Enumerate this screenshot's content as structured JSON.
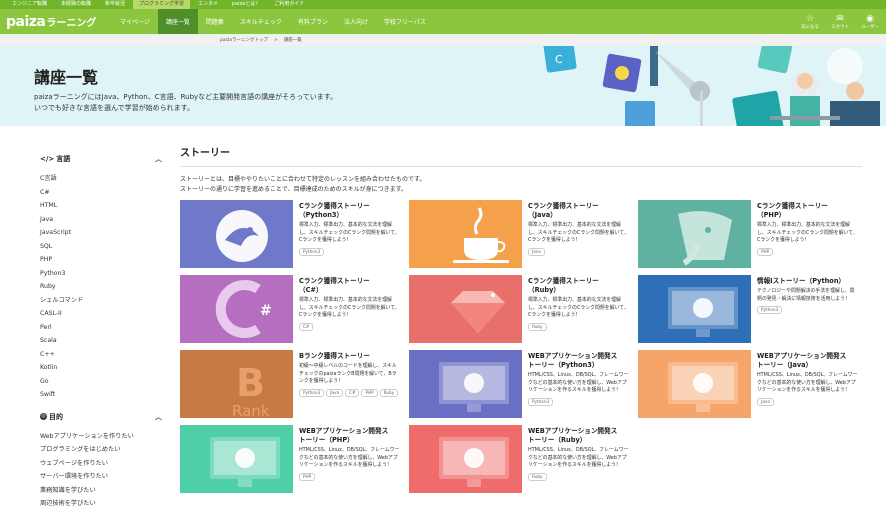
{
  "topbar": {
    "items": [
      {
        "label": "エンジニア転職",
        "active": false
      },
      {
        "label": "未経験の転職",
        "active": false
      },
      {
        "label": "新卒就活",
        "active": false
      },
      {
        "label": "プログラミング学習",
        "active": true
      },
      {
        "label": "エンタメ",
        "active": false
      },
      {
        "label": "paizaとは？",
        "active": false
      },
      {
        "label": "ご利用ガイド",
        "active": false
      }
    ]
  },
  "header": {
    "logo_mark": "paiza",
    "logo_text": "ラーニング",
    "nav": [
      {
        "label": "マイページ",
        "active": false
      },
      {
        "label": "講座一覧",
        "active": true
      },
      {
        "label": "問題集",
        "active": false
      },
      {
        "label": "スキルチェック",
        "active": false
      },
      {
        "label": "有料プラン",
        "active": false
      },
      {
        "label": "法人向け",
        "active": false
      },
      {
        "label": "学校フリーパス",
        "active": false
      }
    ],
    "actions": [
      {
        "label": "気になる",
        "icon": "star-icon"
      },
      {
        "label": "スカウト",
        "icon": "mail-icon"
      },
      {
        "label": "ユーザー",
        "icon": "user-icon"
      }
    ]
  },
  "breadcrumb": {
    "home": "paizaラーニングトップ",
    "sep": ">",
    "current": "講座一覧"
  },
  "hero": {
    "title": "講座一覧",
    "desc1": "paizaラーニングにはJava、Python、C言語、Rubyなど主要開発言語の講座がそろっています。",
    "desc2": "いつでも好きな言語を選んで学習が始められます。"
  },
  "sidebar": {
    "languages_title": "言語",
    "languages": [
      "C言語",
      "C#",
      "HTML",
      "Java",
      "JavaScript",
      "SQL",
      "PHP",
      "Python3",
      "Ruby",
      "シェルコマンド",
      "CASL-II",
      "Perl",
      "Scala",
      "C++",
      "Kotlin",
      "Go",
      "Swift"
    ],
    "purpose_title": "目的",
    "purposes": [
      "Webアプリケーションを作りたい",
      "プログラミングをはじめたい",
      "ウェブページを作りたい",
      "サーバー環境を作りたい",
      "業務知識を学びたい",
      "周辺技術を学びたい"
    ]
  },
  "content": {
    "section_title": "ストーリー",
    "desc1": "ストーリーとは、目標ややりたいことに合わせて特定のレッスンを組み合わせたものです。",
    "desc2": "ストーリーの通りに学習を進めることで、目標達成のためのスキルが身につきます。",
    "cards": [
      {
        "title1": "Cランク獲得ストーリー",
        "title2": "（Python3）",
        "text": "標準入力、標準出力、基本的な文法を理解し、スキルチェックのCランク問題を解いて、Cランクを獲得しよう！",
        "tags": [
          "Python3"
        ],
        "color": "#7079c9",
        "icon": "python-icon"
      },
      {
        "title1": "Cランク獲得ストーリー",
        "title2": "（Java）",
        "text": "標準入力、標準出力、基本的な文法を理解し、スキルチェックのCランク問題を解いて、Cランクを獲得しよう！",
        "tags": [
          "Java"
        ],
        "color": "#f5a04a",
        "icon": "java-icon"
      },
      {
        "title1": "Cランク獲得ストーリー",
        "title2": "（PHP）",
        "text": "標準入力、標準出力、基本的な文法を理解し、スキルチェックのCランク問題を解いて、Cランクを獲得しよう！",
        "tags": [
          "PHP"
        ],
        "color": "#5fb29f",
        "icon": "php-icon"
      },
      {
        "title1": "Cランク獲得ストーリー",
        "title2": "（C#）",
        "text": "標準入力、標準出力、基本的な文法を理解し、スキルチェックのCランク問題を解いて、Cランクを獲得しよう！",
        "tags": [
          "C#"
        ],
        "color": "#b66fc0",
        "icon": "csharp-icon"
      },
      {
        "title1": "Cランク獲得ストーリー",
        "title2": "（Ruby）",
        "text": "標準入力、標準出力、基本的な文法を理解し、スキルチェックのCランク問題を解いて、Cランクを獲得しよう！",
        "tags": [
          "Ruby"
        ],
        "color": "#e8706a",
        "icon": "ruby-icon"
      },
      {
        "title1": "情報Iストーリー（Python）",
        "title2": "",
        "text": "テクノロジーや問題解決の手法を理解し、問題の発見・解決に情報技術を活用しよう！",
        "tags": [
          "Python3"
        ],
        "color": "#2f6fb7",
        "icon": "monitor-icon"
      },
      {
        "title1": "Bランク獲得ストーリー",
        "title2": "",
        "text": "初級〜中級レベルのコードを理解し、スキルチェックのpaizaランクB問題を解いて、Bランクを獲得しよう！",
        "tags": [
          "Python3",
          "Java",
          "C#",
          "PHP",
          "Ruby"
        ],
        "color": "#c87a45",
        "icon": "rank-b-icon",
        "thumb_text": "B",
        "thumb_sub": "Rank"
      },
      {
        "title1": "WEBアプリケーション開発ス",
        "title2": "トーリー（Python3）",
        "text": "HTML/CSS、Linux、DB/SQL、フレームワークなどの基本的な使い方を理解し、Webアプリケーションを作るスキルを獲得しよう！",
        "tags": [
          "Python3"
        ],
        "color": "#6b6fc4",
        "icon": "monitor-icon"
      },
      {
        "title1": "WEBアプリケーション開発ス",
        "title2": "トーリー（Java）",
        "text": "HTML/CSS、Linux、DB/SQL、フレームワークなどの基本的な使い方を理解し、Webアプリケーションを作るスキルを獲得しよう！",
        "tags": [
          "Java"
        ],
        "color": "#f5a56a",
        "icon": "monitor-icon"
      },
      {
        "title1": "WEBアプリケーション開発ス",
        "title2": "トーリー（PHP）",
        "text": "HTML/CSS、Linux、DB/SQL、フレームワークなどの基本的な使い方を理解し、Webアプリケーションを作るスキルを獲得しよう！",
        "tags": [
          "PHP"
        ],
        "color": "#4fcfa8",
        "icon": "monitor-icon"
      },
      {
        "title1": "WEBアプリケーション開発ス",
        "title2": "トーリー（Ruby）",
        "text": "HTML/CSS、Linux、DB/SQL、フレームワークなどの基本的な使い方を理解し、Webアプリケーションを作るスキルを獲得しよう！",
        "tags": [
          "Ruby"
        ],
        "color": "#ee6d6a",
        "icon": "monitor-icon"
      }
    ]
  },
  "colors": {
    "brand_green": "#8cc63f",
    "nav_active": "#4f8f2a",
    "hero_bg": "#dff4f6"
  }
}
